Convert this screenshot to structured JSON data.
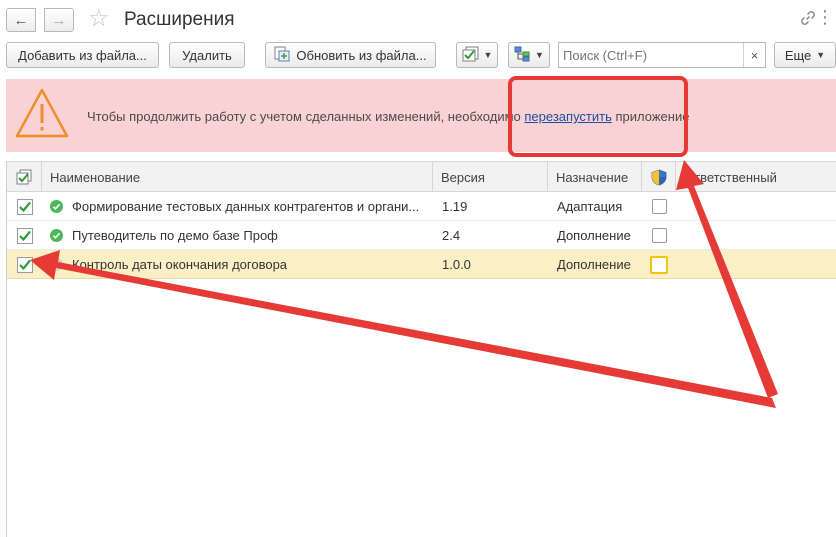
{
  "header": {
    "title": "Расширения",
    "back_icon": "←",
    "forward_icon": "→",
    "star_icon": "☆",
    "link_icon": "🔗",
    "more_icon": "⋮"
  },
  "toolbar": {
    "add_from_file": "Добавить из файла...",
    "delete": "Удалить",
    "update_from_file": "Обновить из файла...",
    "search_placeholder": "Поиск (Ctrl+F)",
    "search_clear": "×",
    "more": "Еще"
  },
  "banner": {
    "text_before": "Чтобы продолжить работу с учетом сделанных изменений, необходимо ",
    "link": "перезапустить",
    "text_after": " приложение"
  },
  "table": {
    "columns": {
      "name": "Наименование",
      "version": "Версия",
      "purpose": "Назначение",
      "responsible": "Ответственный"
    },
    "rows": [
      {
        "name": "Формирование тестовых данных контрагентов и органи...",
        "version": "1.19",
        "purpose": "Адаптация",
        "active": true,
        "status": "ok"
      },
      {
        "name": "Путеводитель по демо базе Проф",
        "version": "2.4",
        "purpose": "Дополнение",
        "active": true,
        "status": "ok"
      },
      {
        "name": "Контроль даты окончания договора",
        "version": "1.0.0",
        "purpose": "Дополнение",
        "active": true,
        "status": "off"
      }
    ]
  },
  "colors": {
    "banner_bg": "#fbd2d3",
    "warning_orange": "#f08c2a",
    "annotation_red": "#e53a35",
    "selected_row": "#fbf0c5",
    "check_green": "#2e9a3c"
  }
}
